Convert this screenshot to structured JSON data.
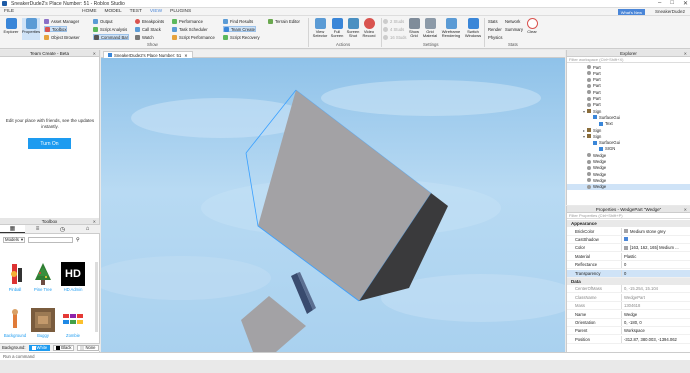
{
  "window": {
    "title": "SneakerDude2's Place Number: 51 - Roblox Studio"
  },
  "menu": {
    "items": [
      "FILE",
      "HOME",
      "MODEL",
      "TEST",
      "VIEW",
      "PLUGINS"
    ],
    "active": "VIEW",
    "whats_new": "What's New",
    "user": "SneakerDude2"
  },
  "ribbon": {
    "big": [
      "Explorer",
      "Properties"
    ],
    "show": [
      "Asset Manager",
      "Toolbox",
      "Object Browser",
      "Output",
      "Script Analysis",
      "Command Bar",
      "Breakpoints",
      "Call Stack",
      "Watch",
      "Performance",
      "Task Scheduler",
      "Script Performance",
      "Find Results",
      "Team Create",
      "Script Recovery",
      "Terrain Editor"
    ],
    "group_show": "Show",
    "actions": [
      "View Selector",
      "Full Screen",
      "Screen Shot",
      "Video Record"
    ],
    "group_actions": "Actions",
    "grid_disabled": [
      "2 Studs",
      "4 Studs",
      "16 Studs"
    ],
    "settings": [
      "Show Grid",
      "Grid Material",
      "Wireframe Rendering",
      "Switch Windows"
    ],
    "group_settings": "Settings",
    "stats": [
      "Stats",
      "Network",
      "Render",
      "Summary",
      "Physics"
    ],
    "clear": "Clear",
    "group_stats": "Stats"
  },
  "team_create": {
    "title": "Team Create - Beta",
    "message": "Edit your place with friends, see the updates instantly.",
    "button": "Turn On"
  },
  "toolbox": {
    "title": "Toolbox",
    "category": "Models",
    "assets": [
      {
        "name": "Pinball"
      },
      {
        "name": "Pine Tree"
      },
      {
        "name": "HD Admin"
      },
      {
        "name": "Background"
      },
      {
        "name": "Buggy"
      },
      {
        "name": "Zombie"
      }
    ],
    "background_label": "Background:",
    "bg_options": [
      "White",
      "Black",
      "None"
    ]
  },
  "document": {
    "tab": "SneakerDude2's Place Number: 51"
  },
  "explorer": {
    "title": "Explorer",
    "filter": "Filter workspace (Ctrl+Shift+X)",
    "items": [
      {
        "label": "Part",
        "depth": 0,
        "kind": "part"
      },
      {
        "label": "Part",
        "depth": 0,
        "kind": "part"
      },
      {
        "label": "Part",
        "depth": 0,
        "kind": "part"
      },
      {
        "label": "Part",
        "depth": 0,
        "kind": "part"
      },
      {
        "label": "Part",
        "depth": 0,
        "kind": "part"
      },
      {
        "label": "Part",
        "depth": 0,
        "kind": "part"
      },
      {
        "label": "Part",
        "depth": 0,
        "kind": "part"
      },
      {
        "label": "Sign",
        "depth": 0,
        "kind": "model",
        "expanded": true
      },
      {
        "label": "SurfaceGui",
        "depth": 1,
        "kind": "gui"
      },
      {
        "label": "Text",
        "depth": 2,
        "kind": "gui"
      },
      {
        "label": "Sign",
        "depth": 0,
        "kind": "model"
      },
      {
        "label": "Sign",
        "depth": 0,
        "kind": "model",
        "expanded": true
      },
      {
        "label": "SurfaceGui",
        "depth": 1,
        "kind": "gui"
      },
      {
        "label": "SIGN",
        "depth": 2,
        "kind": "gui"
      },
      {
        "label": "Wedge",
        "depth": 0,
        "kind": "part"
      },
      {
        "label": "Wedge",
        "depth": 0,
        "kind": "part"
      },
      {
        "label": "Wedge",
        "depth": 0,
        "kind": "part"
      },
      {
        "label": "Wedge",
        "depth": 0,
        "kind": "part"
      },
      {
        "label": "Wedge",
        "depth": 0,
        "kind": "part"
      },
      {
        "label": "Wedge",
        "depth": 0,
        "kind": "part",
        "selected": true
      }
    ]
  },
  "properties": {
    "title": "Properties - WedgePart \"Wedge\"",
    "filter": "Filter Properties (Ctrl+Shift+P)",
    "sections": [
      {
        "name": "Appearance",
        "rows": [
          {
            "name": "BrickColor",
            "value": "Medium stone grey",
            "swatch": "#a3a2a5"
          },
          {
            "name": "CastShadow",
            "value": "",
            "check": true
          },
          {
            "name": "Color",
            "value": "[163, 162, 165] Medium ...",
            "swatch": "#a3a2a5"
          },
          {
            "name": "Material",
            "value": "Plastic"
          },
          {
            "name": "Reflectance",
            "value": "0"
          },
          {
            "name": "Transparency",
            "value": "0",
            "selected": true
          }
        ]
      },
      {
        "name": "Data",
        "rows": [
          {
            "name": "CenterOfMass",
            "value": "0, -15.254, 15.104",
            "ro": true
          },
          {
            "name": "ClassName",
            "value": "WedgePart",
            "ro": true
          },
          {
            "name": "Mass",
            "value": "1304618",
            "ro": true
          },
          {
            "name": "Name",
            "value": "Wedge"
          },
          {
            "name": "Orientation",
            "value": "0, -180, 0"
          },
          {
            "name": "Parent",
            "value": "Workspace"
          },
          {
            "name": "Position",
            "value": "-312.87, 380.003, -1394.062"
          }
        ]
      }
    ]
  },
  "command_bar": {
    "placeholder": "Run a command"
  },
  "colors": {
    "accent": "#1d9bf0",
    "sky_top": "#8fc2e9",
    "part": "#a3a2a5"
  }
}
